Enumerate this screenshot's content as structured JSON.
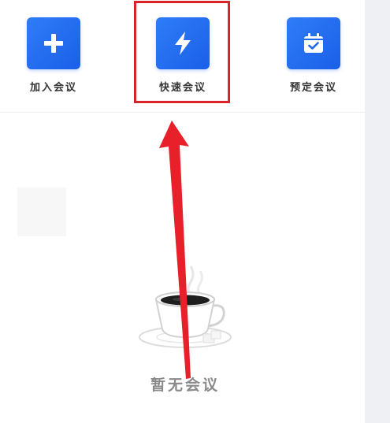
{
  "actions": {
    "join": {
      "label": "加入会议",
      "icon": "plus-icon"
    },
    "quick": {
      "label": "快速会议",
      "icon": "lightning-icon"
    },
    "schedule": {
      "label": "预定会议",
      "icon": "calendar-check-icon"
    }
  },
  "empty_state": {
    "icon": "coffee-cup-icon",
    "text": "暂无会议"
  },
  "annotation": {
    "highlight_target": "快速会议",
    "highlight_color": "#d9232d",
    "arrow_color": "#e8202a"
  },
  "colors": {
    "accent": "#1a5fe8",
    "accent_light": "#2f7df7",
    "label_text": "#333333",
    "muted_text": "#8a8a8a"
  }
}
